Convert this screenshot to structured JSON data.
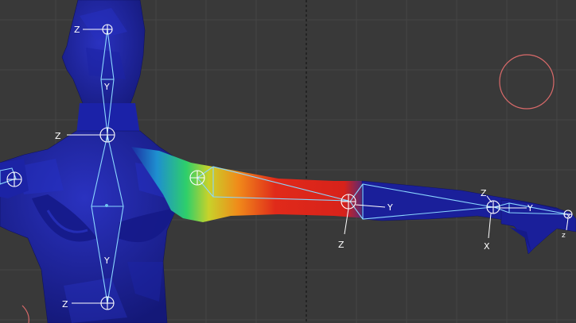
{
  "viewport": {
    "background": "#393939",
    "grid_color": "#474747",
    "center_line_color": "#1f1f1f",
    "mesh_color": "#1a1f9a",
    "bone_color": "#7fd1ff",
    "cursor_color": "#d96a6a"
  },
  "weight_gradient": [
    "#1a1f9a",
    "#1e8fd0",
    "#2ecf6a",
    "#c8d22a",
    "#f08a1a",
    "#e02a1a"
  ],
  "axis_labels": {
    "head_z": "Z",
    "head_y": "Y",
    "neck_z": "Z",
    "neck_y": "Y",
    "chest_z": "Z",
    "chest_y": "Y",
    "elbow_z": "Z",
    "elbow_y": "Y",
    "wrist_z": "Z",
    "wrist_x": "X",
    "wrist_y": "Y",
    "hand_z": "z",
    "hand_x": "x"
  },
  "icons": [
    "3d-cursor-icon",
    "bone-joint-icon"
  ]
}
